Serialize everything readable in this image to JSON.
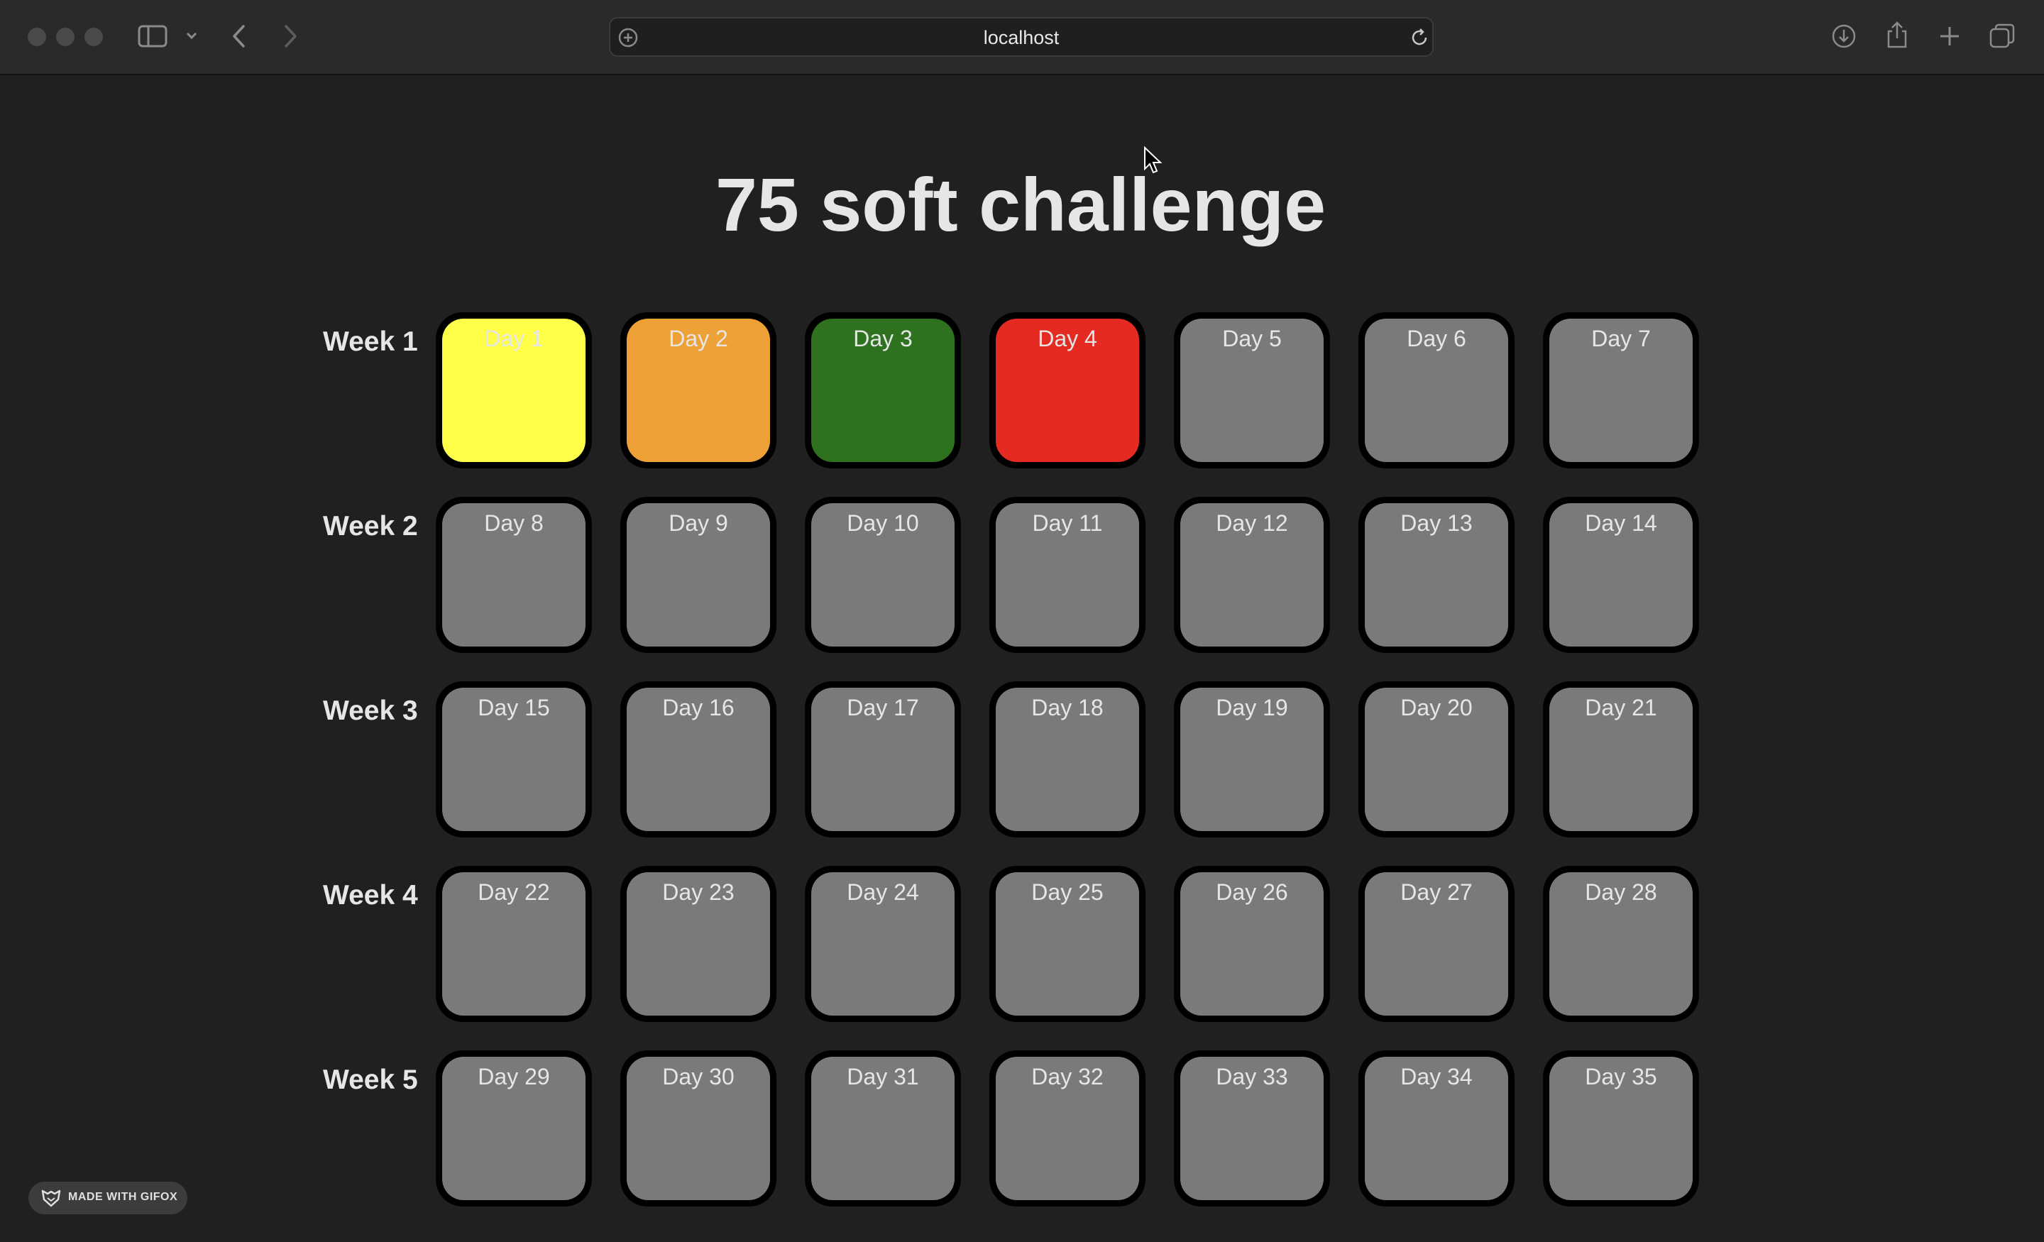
{
  "browser": {
    "url": "localhost"
  },
  "page": {
    "title": "75 soft challenge"
  },
  "colors": {
    "page_background": "#202020",
    "cell_border": "#000000",
    "empty_day": "#7a7a7a",
    "yellow": "#ffff4a",
    "orange": "#eea136",
    "green": "#2e721f",
    "red": "#e52a22"
  },
  "weeks": [
    {
      "label": "Week 1",
      "days": [
        {
          "label": "Day 1",
          "color": "#ffff4a"
        },
        {
          "label": "Day 2",
          "color": "#eea136"
        },
        {
          "label": "Day 3",
          "color": "#2e721f"
        },
        {
          "label": "Day 4",
          "color": "#e52a22"
        },
        {
          "label": "Day 5",
          "color": "#7a7a7a"
        },
        {
          "label": "Day 6",
          "color": "#7a7a7a"
        },
        {
          "label": "Day 7",
          "color": "#7a7a7a"
        }
      ]
    },
    {
      "label": "Week 2",
      "days": [
        {
          "label": "Day 8",
          "color": "#7a7a7a"
        },
        {
          "label": "Day 9",
          "color": "#7a7a7a"
        },
        {
          "label": "Day 10",
          "color": "#7a7a7a"
        },
        {
          "label": "Day 11",
          "color": "#7a7a7a"
        },
        {
          "label": "Day 12",
          "color": "#7a7a7a"
        },
        {
          "label": "Day 13",
          "color": "#7a7a7a"
        },
        {
          "label": "Day 14",
          "color": "#7a7a7a"
        }
      ]
    },
    {
      "label": "Week 3",
      "days": [
        {
          "label": "Day 15",
          "color": "#7a7a7a"
        },
        {
          "label": "Day 16",
          "color": "#7a7a7a"
        },
        {
          "label": "Day 17",
          "color": "#7a7a7a"
        },
        {
          "label": "Day 18",
          "color": "#7a7a7a"
        },
        {
          "label": "Day 19",
          "color": "#7a7a7a"
        },
        {
          "label": "Day 20",
          "color": "#7a7a7a"
        },
        {
          "label": "Day 21",
          "color": "#7a7a7a"
        }
      ]
    },
    {
      "label": "Week 4",
      "days": [
        {
          "label": "Day 22",
          "color": "#7a7a7a"
        },
        {
          "label": "Day 23",
          "color": "#7a7a7a"
        },
        {
          "label": "Day 24",
          "color": "#7a7a7a"
        },
        {
          "label": "Day 25",
          "color": "#7a7a7a"
        },
        {
          "label": "Day 26",
          "color": "#7a7a7a"
        },
        {
          "label": "Day 27",
          "color": "#7a7a7a"
        },
        {
          "label": "Day 28",
          "color": "#7a7a7a"
        }
      ]
    },
    {
      "label": "Week 5",
      "days": [
        {
          "label": "Day 29",
          "color": "#7a7a7a"
        },
        {
          "label": "Day 30",
          "color": "#7a7a7a"
        },
        {
          "label": "Day 31",
          "color": "#7a7a7a"
        },
        {
          "label": "Day 32",
          "color": "#7a7a7a"
        },
        {
          "label": "Day 33",
          "color": "#7a7a7a"
        },
        {
          "label": "Day 34",
          "color": "#7a7a7a"
        },
        {
          "label": "Day 35",
          "color": "#7a7a7a"
        }
      ]
    }
  ],
  "badge": {
    "text": "MADE WITH GIFOX"
  }
}
